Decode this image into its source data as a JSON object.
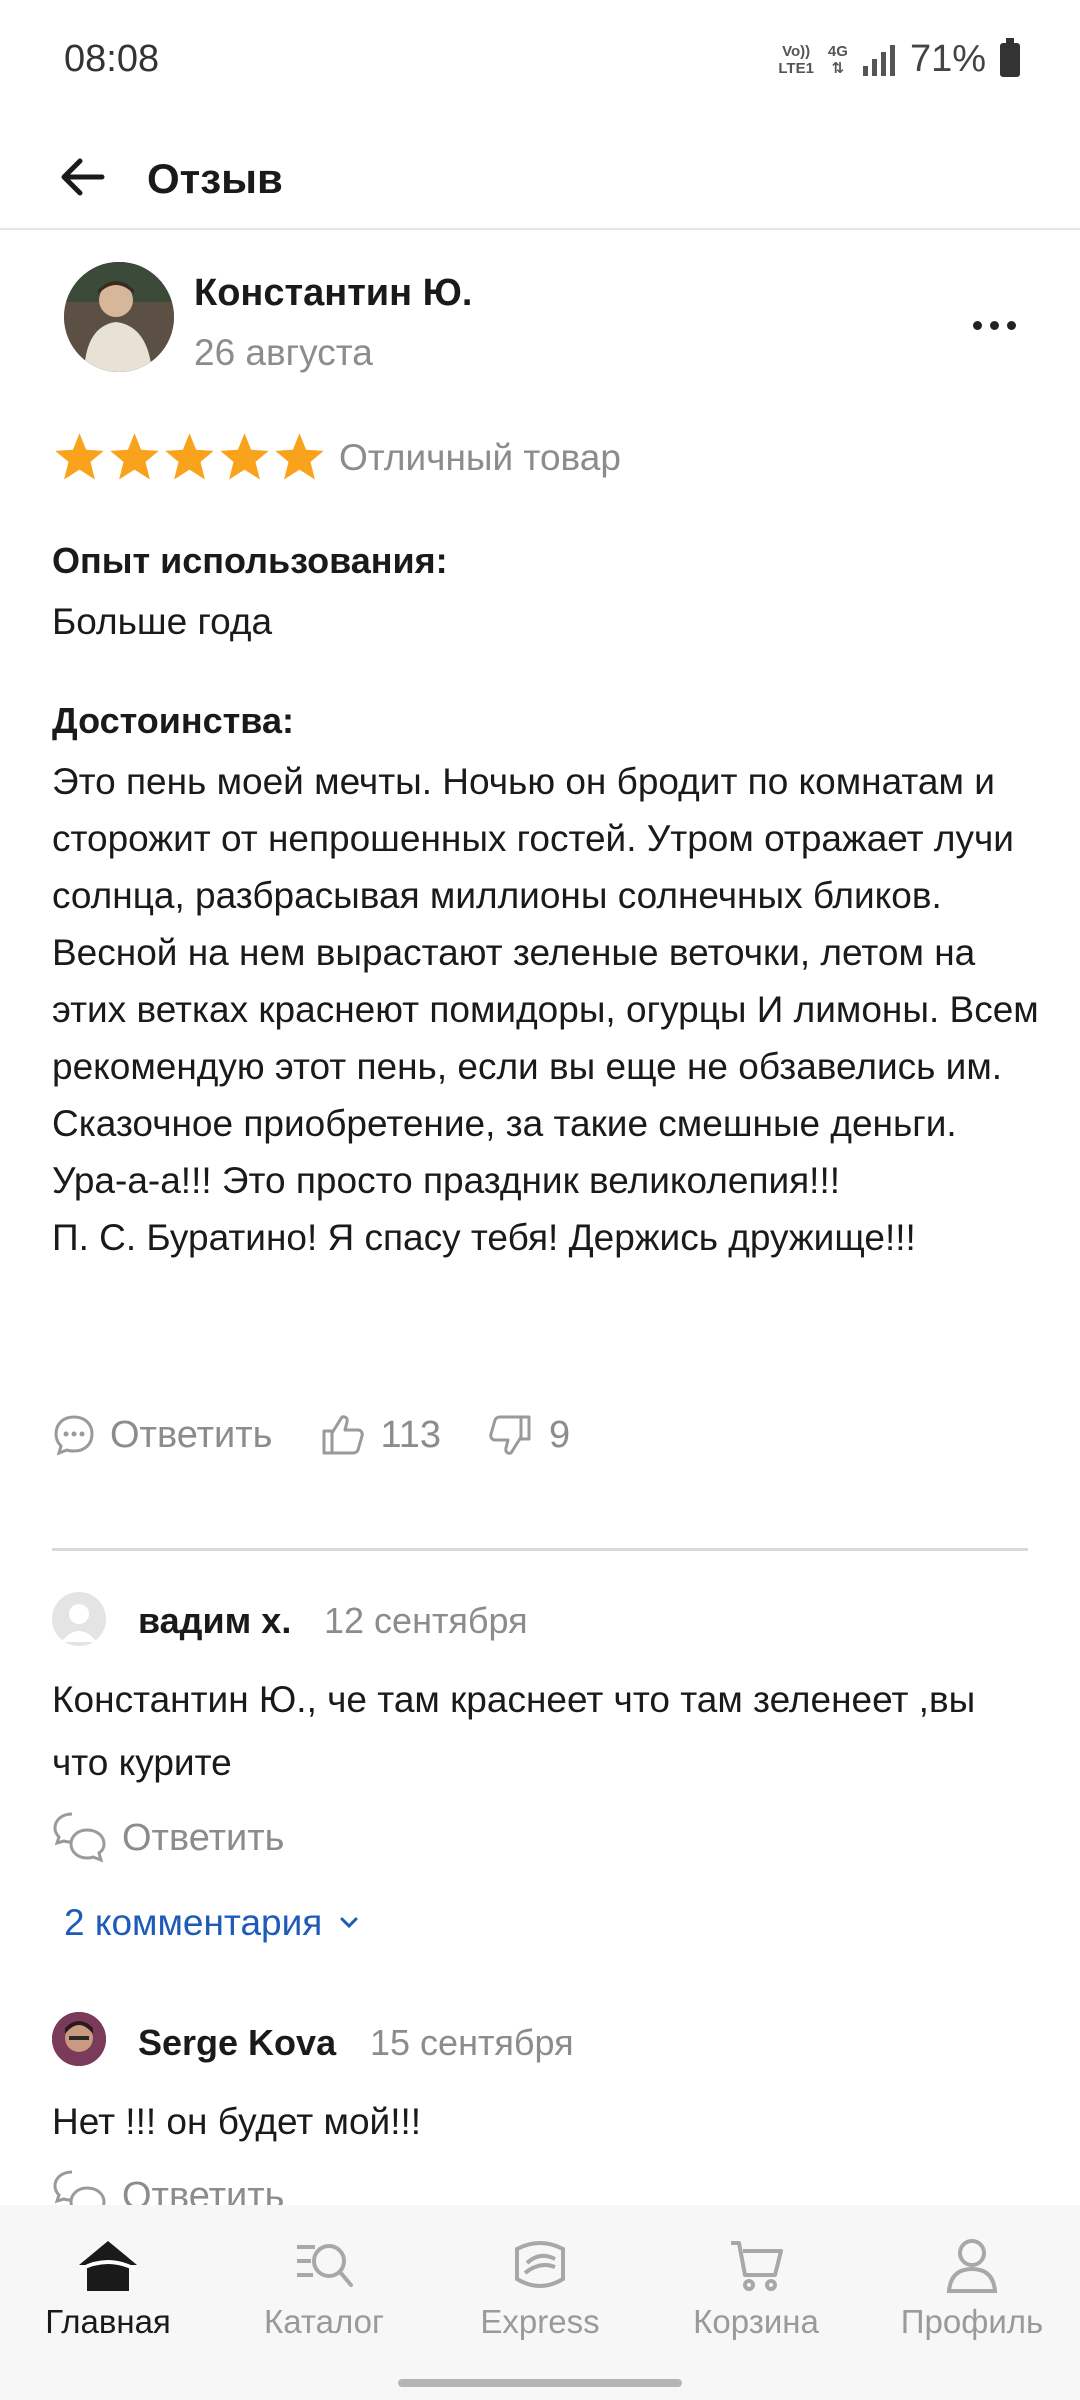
{
  "status_bar": {
    "time": "08:08",
    "net_volte_top": "Vo))",
    "net_volte_bottom": "LTE1",
    "net_4g": "4G",
    "battery": "71%"
  },
  "header": {
    "title": "Отзыв"
  },
  "review": {
    "author": "Константин Ю.",
    "date": "26 августа",
    "rating": 5,
    "rating_max": 5,
    "rating_text": "Отличный товар",
    "experience_label": "Опыт использования:",
    "experience_value": "Больше года",
    "pros_label": "Достоинства:",
    "pros_text": "Это пень моей мечты. Ночью он бродит по комнатам и сторожит от непрошенных гостей. Утром отражает лучи солнца, разбрасывая миллионы солнечных бликов. Весной на нем вырастают зеленые веточки, летом на этих ветках краснеют помидоры, огурцы И лимоны. Всем рекомендую этот пень, если вы еще не обзавелись им. Сказочное приобретение, за такие смешные деньги. Ура-а-а!!! Это просто праздник великолепия!!!\nП. С. Буратино! Я спасу тебя! Держись дружище!!!",
    "reply_label": "Ответить",
    "likes": "113",
    "dislikes": "9",
    "star_color": "#f9a21b"
  },
  "comments": [
    {
      "author": "вадим х.",
      "date": "12 сентября",
      "text": "Константин Ю., че там краснеет что там зеленеет ,вы что курите",
      "reply_label": "Ответить"
    },
    {
      "author": "Serge Kova",
      "date": "15 сентября",
      "text": "Нет !!! он будет мой!!!",
      "reply_label": "Ответить"
    }
  ],
  "more_comments_label": "2 комментария",
  "bottom_nav": [
    {
      "label": "Главная",
      "icon": "home-icon",
      "active": true
    },
    {
      "label": "Каталог",
      "icon": "catalog-search-icon",
      "active": false
    },
    {
      "label": "Express",
      "icon": "express-icon",
      "active": false
    },
    {
      "label": "Корзина",
      "icon": "cart-icon",
      "active": false
    },
    {
      "label": "Профиль",
      "icon": "profile-icon",
      "active": false
    }
  ],
  "colors": {
    "accent_link": "#1e5bb8",
    "muted_text": "#8c8c8c",
    "star": "#f9a21b"
  }
}
